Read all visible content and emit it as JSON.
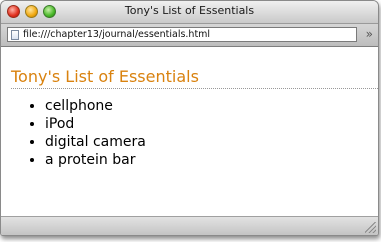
{
  "window": {
    "title": "Tony's List of Essentials"
  },
  "toolbar": {
    "address": "file:///chapter13/journal/essentials.html",
    "address_icon": "page-icon",
    "overflow_label": "»"
  },
  "page": {
    "heading": "Tony's List of Essentials",
    "heading_color": "#d9820f",
    "items": [
      {
        "label": "cellphone"
      },
      {
        "label": "iPod"
      },
      {
        "label": "digital camera"
      },
      {
        "label": "a protein bar"
      }
    ]
  }
}
